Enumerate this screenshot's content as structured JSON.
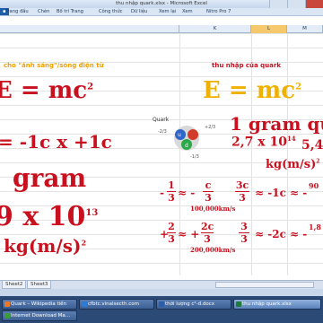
{
  "window": {
    "title": "thu nhập quark.xlsx - Microsoft Excel"
  },
  "ribbon": {
    "tabs": [
      "Trang đầu",
      "Chèn",
      "Bố trí Trang",
      "Công thức",
      "Dữ liệu",
      "Xem lại",
      "Xem",
      "Nitro Pro 7"
    ]
  },
  "columns": [
    "",
    "K",
    "L",
    "M"
  ],
  "sheet_left": {
    "header": "cho \"ánh sáng\"/sóng điện từ",
    "formula": "E = mc",
    "formula_sup": "2",
    "eq1": "= -1c x +1c",
    "mass": "gram",
    "power_left": "9 x 10",
    "power_sup": "13",
    "unit": "kg(m/s)",
    "unit_sup": "2"
  },
  "sheet_right": {
    "header": "thu nhập của quark",
    "formula": "E = mc",
    "formula_sup": "2",
    "mass": "1 gram qu",
    "value": "2,7 x 10",
    "value_sup": "14",
    "value2": "5,4",
    "unit": "kg(m/s)",
    "unit_sup": "2",
    "row1_left": "-",
    "row1_frac1_num": "1",
    "row1_frac1_den": "3",
    "row1_mid": "≈ -",
    "row1_frac2_num": "c",
    "row1_frac2_den": "3",
    "row1_frac3_num": "3c",
    "row1_frac3_den": "3",
    "row1_right": "≈ -1c ≈ -",
    "row1_speed": "100,000km/s",
    "row2_frac1_num": "2",
    "row2_frac1_den": "3",
    "row2_frac2_num": "2c",
    "row2_frac2_den": "3",
    "row2_frac3_num": "3",
    "row2_frac3_den": "3",
    "row2_right": "≈ -2c ≈ -",
    "row2_speed": "200,000km/s",
    "row1_tail": "90",
    "row2_tail": "1,8"
  },
  "quark_diagram": {
    "label": "Quark",
    "left_label": "-2/3",
    "right_label": "+2/3",
    "bottom_label": "-1/3",
    "u_label": "u",
    "d_label": "d"
  },
  "sheets": [
    "Sheet2",
    "Sheet3"
  ],
  "taskbar": {
    "items": [
      {
        "label": "Quark – Wikipedia tiến",
        "color": "#e8792a"
      },
      {
        "label": "cfbtc.vinalsecth.com",
        "color": "#2d7bd6"
      },
      {
        "label": "thời lượng c²-đ.docx",
        "color": "#2a5dab"
      },
      {
        "label": "thu nhập quark.xlsx",
        "color": "#1e7b3a"
      },
      {
        "label": "Internet Download Ma…",
        "color": "#3c9c3c"
      }
    ]
  }
}
